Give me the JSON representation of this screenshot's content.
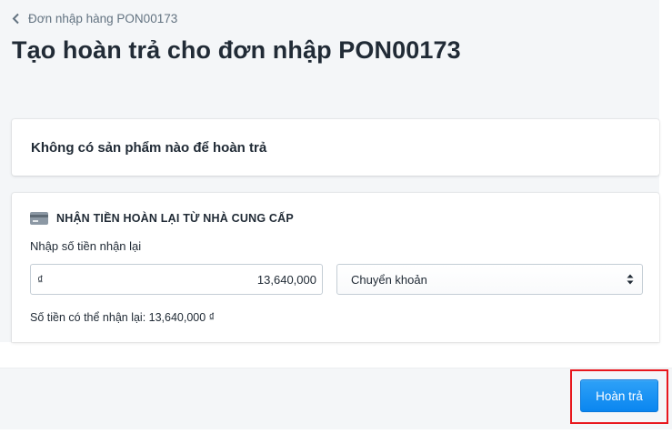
{
  "breadcrumb": {
    "label": "Đơn nhập hàng PON00173",
    "icon": "chevron-left-icon"
  },
  "page_title": "Tạo hoàn trả cho đơn nhập PON00173",
  "empty_card": {
    "message": "Không có sản phẩm nào để hoàn trả"
  },
  "refund_section": {
    "icon": "credit-card-icon",
    "title": "NHẬN TIỀN HOÀN LẠI TỪ NHÀ CUNG CẤP",
    "amount_label": "Nhập số tiền nhận lại",
    "currency_symbol": "₫",
    "amount_value": "13,640,000",
    "payment_method": "Chuyển khoản",
    "available_text": "Số tiền có thể nhận lại: 13,640,000 ₫"
  },
  "footer": {
    "submit_label": "Hoàn trả"
  },
  "colors": {
    "primary": "#0a86f0",
    "highlight": "#e8171d",
    "background": "#f4f6f8",
    "text": "#212b36",
    "muted": "#637381"
  }
}
